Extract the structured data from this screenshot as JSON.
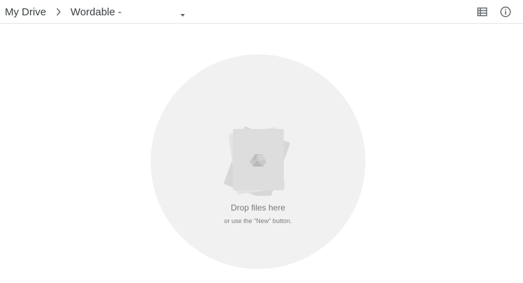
{
  "breadcrumb": {
    "root": "My Drive",
    "separator_icon": "chevron-right-icon",
    "current": "Wordable -",
    "dropdown_icon": "caret-down-icon"
  },
  "toolbar": {
    "list_view_icon": "list-view-icon",
    "info_icon": "info-icon"
  },
  "empty_state": {
    "title": "Drop files here",
    "subtitle": "or use the \"New\" button.",
    "illustration_icon": "google-drive-icon"
  },
  "colors": {
    "top_text": "#3c4043",
    "icon_gray": "#5f6368",
    "drop_zone_bg": "#f1f1f1",
    "muted_text": "#777777",
    "divider": "#e6e6e6"
  }
}
